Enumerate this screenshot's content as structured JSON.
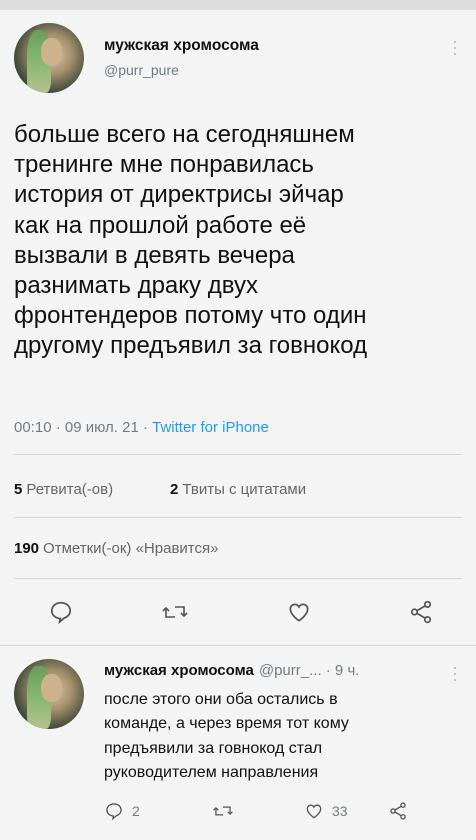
{
  "tweet": {
    "author_name": "мужская хромосома",
    "author_handle": "@purr_pure",
    "lines": [
      "больше всего на сегодняшнем",
      "тренинге мне понравилась",
      "история от директрисы эйчар",
      "как на прошлой работе её",
      "вызвали в девять вечера",
      "разнимать драку двух",
      "фронтендеров потому что один",
      "другому предъявил за говнокод"
    ],
    "time": "00:10 · 09 июл. 21 · ",
    "source": "Twitter for iPhone",
    "retweets_count": "5",
    "retweets_label": "Ретвита(-ов)",
    "quotes_count": "2",
    "quotes_label": "Твиты с цитатами",
    "likes_count": "190",
    "likes_label": "Отметки(-ок) «Нравится»"
  },
  "reply": {
    "author_name": "мужская хромосома",
    "handle_time": "@purr_... · 9 ч.",
    "lines": [
      "после этого они оба остались в",
      "команде, а через время тот кому",
      "предъявили за говнокод стал",
      "руководителем направления"
    ],
    "reply_count": "2",
    "like_count": "33"
  },
  "icons": [
    "reply-icon",
    "retweet-icon",
    "like-icon",
    "share-icon",
    "more-icon"
  ],
  "colors": {
    "link": "#1d9bf0",
    "secondary": "#6f7c86",
    "background": "#f4f4f4"
  }
}
